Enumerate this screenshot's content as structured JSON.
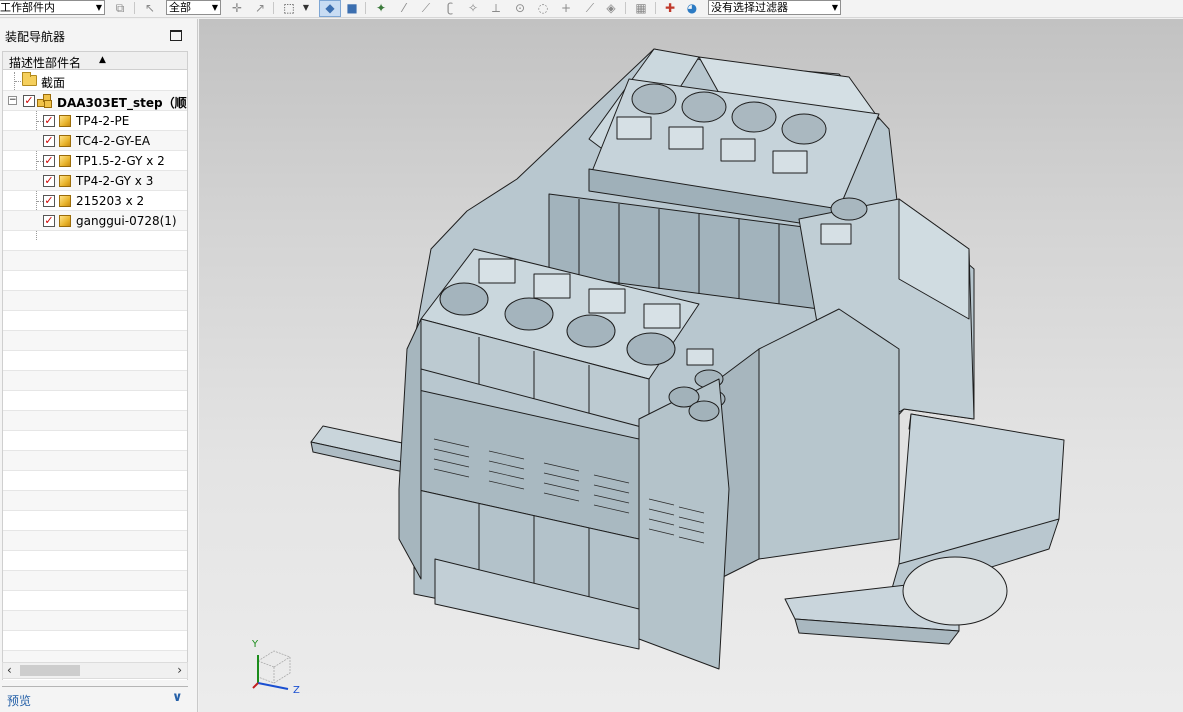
{
  "toolbar": {
    "selection_scope": "工作部件内",
    "type_filter": "全部",
    "selection_filter": "没有选择过滤器"
  },
  "navigator": {
    "title": "装配导航器",
    "column_header": "描述性部件名",
    "items": [
      {
        "label": "截面",
        "type": "folder",
        "checked": null
      },
      {
        "label": "DAA303ET_step（顺序",
        "type": "assembly",
        "checked": true
      },
      {
        "label": "TP4-2-PE",
        "type": "part",
        "checked": true
      },
      {
        "label": "TC4-2-GY-EA",
        "type": "part",
        "checked": true
      },
      {
        "label": "TP1.5-2-GY x 2",
        "type": "part",
        "checked": true
      },
      {
        "label": "TP4-2-GY x 3",
        "type": "part",
        "checked": true
      },
      {
        "label": "215203 x 2",
        "type": "part",
        "checked": true
      },
      {
        "label": "ganggui-0728(1)",
        "type": "part",
        "checked": true
      }
    ],
    "preview_label": "预览"
  },
  "triad": {
    "y": "Y",
    "z": "Z"
  },
  "colors": {
    "model_face": "#c3d1d9",
    "model_edge": "#1e1e1e",
    "rail": "#cdd9df",
    "background_top": "#c2c2c2",
    "background_bottom": "#ececec"
  }
}
